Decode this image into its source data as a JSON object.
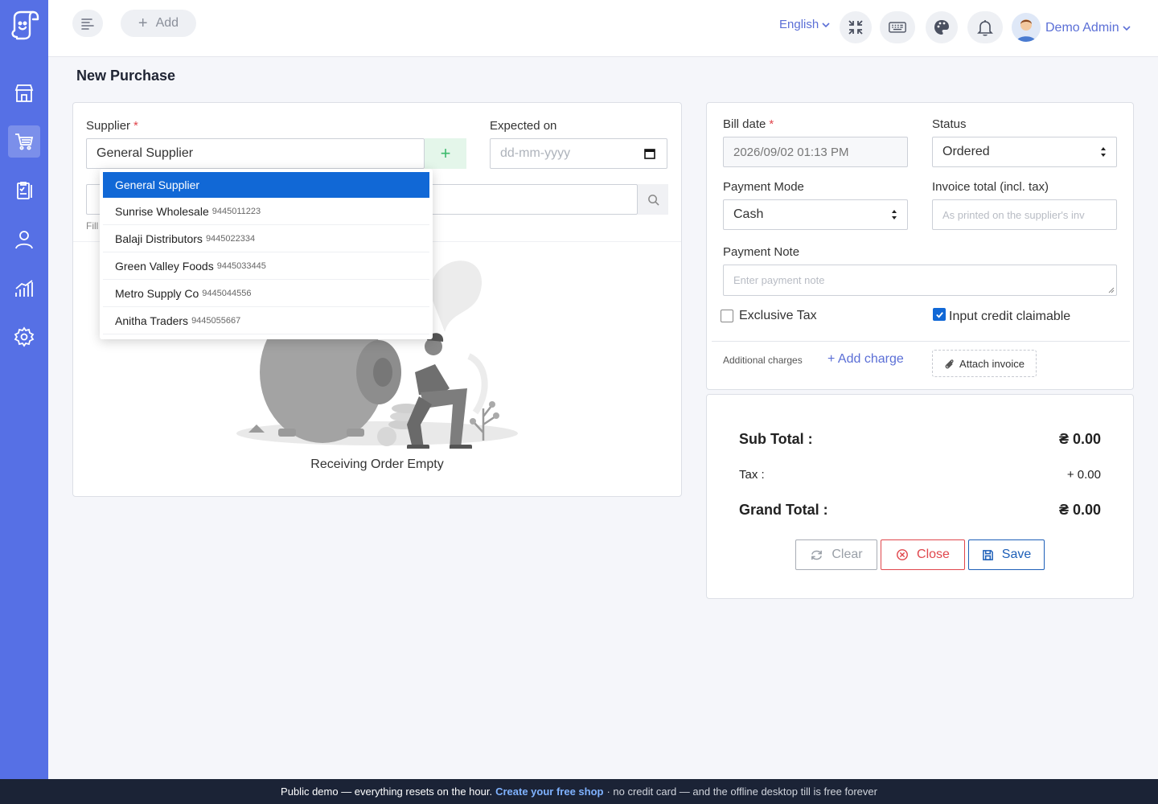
{
  "topbar": {
    "add_label": "Add",
    "language": "English",
    "user_name": "Demo Admin",
    "icons": [
      "menu-icon",
      "fullscreen-icon",
      "keyboard-icon",
      "palette-icon",
      "bell-icon"
    ]
  },
  "sidebar": {
    "items": [
      "store-icon",
      "cart-icon",
      "clipboard-icon",
      "user-icon",
      "chart-icon",
      "gear-icon"
    ],
    "active": "cart-icon",
    "color": "#5670e5"
  },
  "page": {
    "title": "New Purchase"
  },
  "form": {
    "supplier_label": "Supplier",
    "supplier_value": "General Supplier",
    "expected_label": "Expected on",
    "expected_placeholder": "dd-mm-yyyy",
    "hint": "Fill",
    "empty_text": "Receiving Order Empty"
  },
  "dropdown": {
    "items": [
      {
        "name": "General Supplier",
        "phone": ""
      },
      {
        "name": "Sunrise Wholesale",
        "phone": "9445011223"
      },
      {
        "name": "Balaji Distributors",
        "phone": "9445022334"
      },
      {
        "name": "Green Valley Foods",
        "phone": "9445033445"
      },
      {
        "name": "Metro Supply Co",
        "phone": "9445044556"
      },
      {
        "name": "Anitha Traders",
        "phone": "9445055667"
      }
    ]
  },
  "bill": {
    "bill_date_label": "Bill date",
    "bill_date_value": "2026/09/02 01:13 PM",
    "status_label": "Status",
    "status_value": "Ordered",
    "payment_mode_label": "Payment Mode",
    "payment_mode_value": "Cash",
    "invoice_total_label": "Invoice total (incl. tax)",
    "invoice_total_placeholder": "As printed on the supplier's inv",
    "payment_note_label": "Payment Note",
    "payment_note_placeholder": "Enter payment note",
    "exclusive_tax_label": "Exclusive Tax",
    "exclusive_tax_checked": false,
    "input_credit_label": "Input credit claimable",
    "input_credit_checked": true,
    "additional_charges_label": "Additional charges",
    "add_charge_label": "+ Add charge",
    "attach_invoice_label": "Attach invoice"
  },
  "totals": {
    "sub_total_label": "Sub Total :",
    "sub_total_value": "₴ 0.00",
    "tax_label": "Tax :",
    "tax_value": "+ 0.00",
    "grand_total_label": "Grand Total :",
    "grand_total_value": "₴ 0.00",
    "clear_label": "Clear",
    "close_label": "Close",
    "save_label": "Save"
  },
  "footer": {
    "lead": "Public demo — everything resets on the hour.",
    "link": "Create your free shop",
    "tail": "· no credit card — and the offline desktop till is free forever"
  }
}
